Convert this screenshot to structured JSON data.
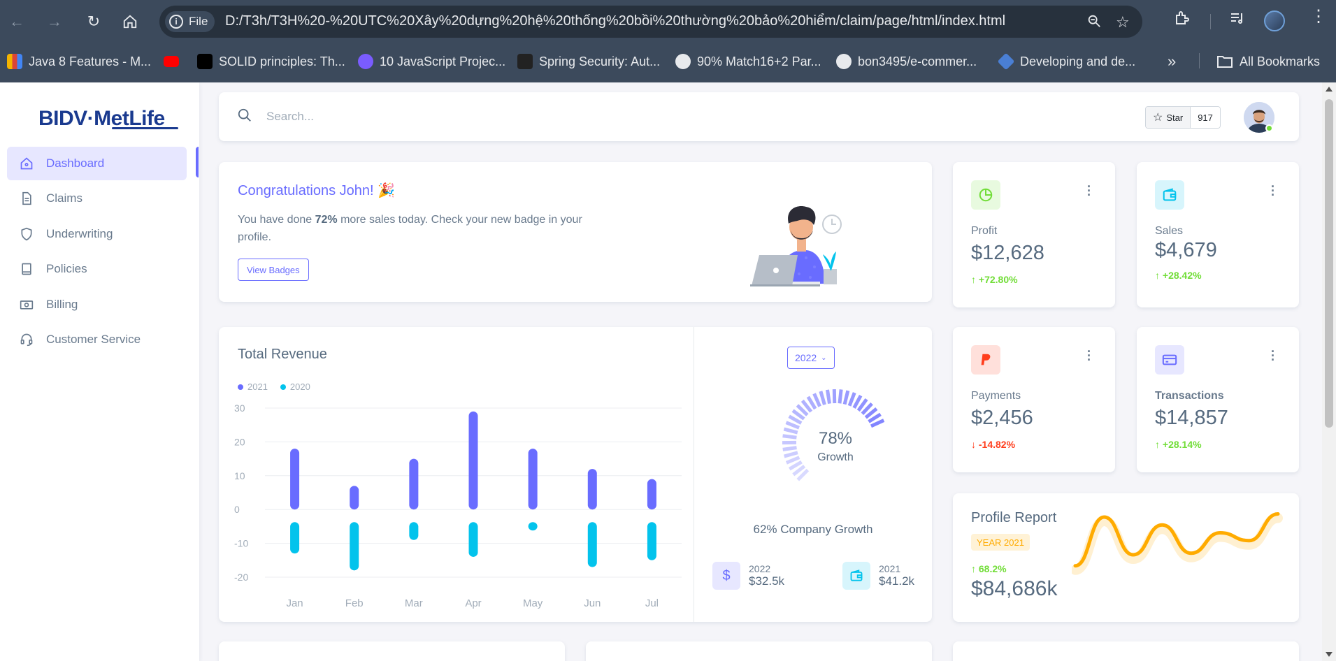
{
  "browser": {
    "file_label": "File",
    "url": "D:/T3h/T3H%20-%20UTC%20Xây%20dựng%20hệ%20thống%20bồi%20thường%20bảo%20hiểm/claim/page/html/index.html",
    "bookmarks": [
      {
        "label": "Java 8 Features - M...",
        "color": "#f4b400"
      },
      {
        "label": "",
        "color": "#ff0000"
      },
      {
        "label": "SOLID principles: Th...",
        "color": "#000000"
      },
      {
        "label": "10 JavaScript Projec...",
        "color": "#7a5cff"
      },
      {
        "label": "Spring Security: Aut...",
        "color": "#222222"
      },
      {
        "label": "90% Match16+2 Par...",
        "color": "#e8eaed"
      },
      {
        "label": "bon3495/e-commer...",
        "color": "#e8eaed"
      },
      {
        "label": "Developing and de...",
        "color": "#4a7fd4"
      }
    ],
    "all_bookmarks": "All Bookmarks"
  },
  "sidebar": {
    "logo": "BIDV·MetLife",
    "items": [
      {
        "label": "Dashboard",
        "icon": "home-icon",
        "active": true
      },
      {
        "label": "Claims",
        "icon": "document-icon"
      },
      {
        "label": "Underwriting",
        "icon": "shield-icon"
      },
      {
        "label": "Policies",
        "icon": "book-icon"
      },
      {
        "label": "Billing",
        "icon": "cash-icon"
      },
      {
        "label": "Customer Service",
        "icon": "headset-icon"
      }
    ]
  },
  "search": {
    "placeholder": "Search..."
  },
  "github": {
    "star_label": "Star",
    "count": "917"
  },
  "congrats": {
    "title": "Congratulations John! 🎉",
    "text_pre": "You have done ",
    "text_bold": "72%",
    "text_post": " more sales today. Check your new badge in your profile.",
    "button": "View Badges"
  },
  "stats": [
    {
      "label": "Profit",
      "value": "$12,628",
      "change": "+72.80%",
      "dir": "up",
      "icon": "pie-chart-icon",
      "tint": "#e8fadf",
      "fg": "#71dd37"
    },
    {
      "label": "Sales",
      "value": "$4,679",
      "change": "+28.42%",
      "dir": "up",
      "icon": "wallet-icon",
      "tint": "#d7f5fc",
      "fg": "#03c3ec"
    },
    {
      "label": "Payments",
      "value": "$2,456",
      "change": "-14.82%",
      "dir": "down",
      "icon": "paypal-icon",
      "tint": "#ffe0db",
      "fg": "#ff3e1d"
    },
    {
      "label": "Transactions",
      "value": "$14,857",
      "change": "+28.14%",
      "dir": "up",
      "icon": "credit-card-icon",
      "tint": "#e7e7ff",
      "fg": "#696cff"
    }
  ],
  "revenue": {
    "title": "Total Revenue",
    "year_button": "2022",
    "growth_pct": "78%",
    "growth_label": "Growth",
    "growth_value": 78,
    "company_growth": "62% Company Growth",
    "mini": [
      {
        "year": "2022",
        "value": "$32.5k",
        "icon": "dollar-icon",
        "tint": "#e7e7ff",
        "fg": "#696cff"
      },
      {
        "year": "2021",
        "value": "$41.2k",
        "icon": "wallet-icon",
        "tint": "#d7f5fc",
        "fg": "#03c3ec"
      }
    ]
  },
  "chart_data": {
    "type": "bar",
    "categories": [
      "Jan",
      "Feb",
      "Mar",
      "Apr",
      "May",
      "Jun",
      "Jul"
    ],
    "series": [
      {
        "name": "2021",
        "values": [
          18,
          7,
          15,
          29,
          18,
          12,
          9
        ],
        "color": "#696cff"
      },
      {
        "name": "2020",
        "values": [
          -13,
          -18,
          -9,
          -14,
          -5,
          -17,
          -15
        ],
        "color": "#03c3ec"
      }
    ],
    "y_ticks": [
      "30",
      "20",
      "10",
      "0",
      "-10",
      "-20"
    ],
    "ylim": [
      -20,
      30
    ],
    "grid": true,
    "legend": "top-left"
  },
  "profile_report": {
    "title": "Profile Report",
    "badge": "YEAR 2021",
    "change": "68.2%",
    "value": "$84,686k",
    "line_values": [
      5,
      36,
      12,
      31,
      13,
      26,
      21,
      38
    ]
  }
}
